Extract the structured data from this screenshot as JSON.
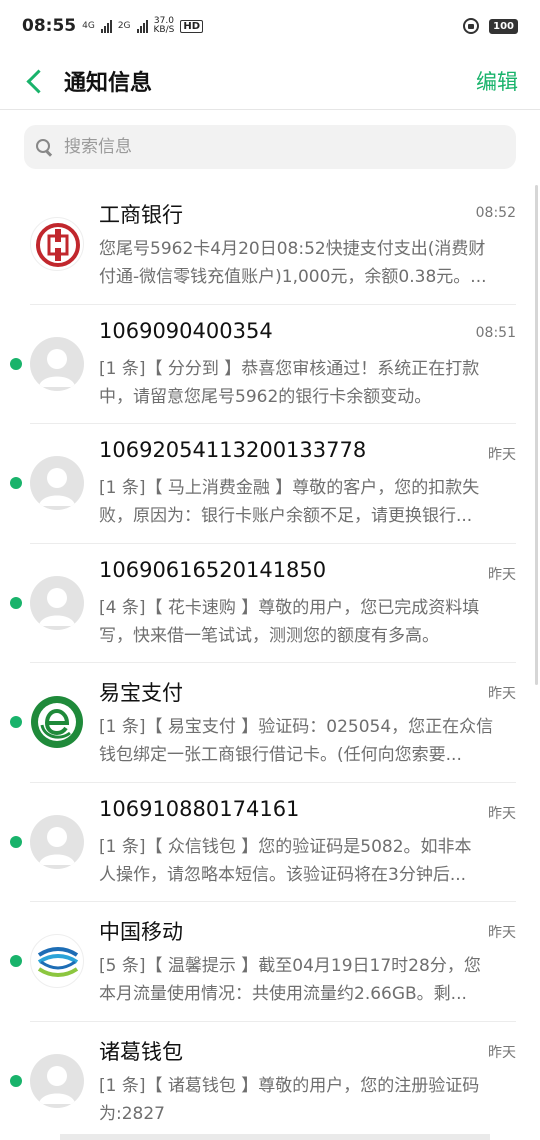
{
  "status": {
    "time": "08:55",
    "net": "4G",
    "net2": "2G",
    "speed_value": "37.0",
    "speed_unit": "KB/S",
    "hd": "HD",
    "battery": "100"
  },
  "header": {
    "title": "通知信息",
    "edit_label": "编辑"
  },
  "search": {
    "placeholder": "搜索信息"
  },
  "colors": {
    "accent": "#19b36b",
    "unread_dot": "#19b36b",
    "icbc_red": "#c1272d",
    "yeepay_green": "#1f8a3a",
    "cmcc_blue": "#1d6db5"
  },
  "messages": [
    {
      "sender": "工商银行",
      "time": "08:52",
      "unread": false,
      "avatar": "icbc-logo-icon",
      "line1": "您尾号5962卡4月20日08:52快捷支付支出(消费财",
      "line2": "付通-微信零钱充值账户)1,000元，余额0.38元。..."
    },
    {
      "sender": "1069090400354",
      "time": "08:51",
      "unread": true,
      "avatar": "default-avatar-icon",
      "line1": "[1 条]【 分分到 】恭喜您审核通过！系统正在打款",
      "line2": "中，请留意您尾号5962的银行卡余额变动。"
    },
    {
      "sender": "10692054113200133778",
      "time": "昨天",
      "unread": true,
      "avatar": "default-avatar-icon",
      "line1": "[1 条]【 马上消费金融 】尊敬的客户，您的扣款失",
      "line2": "败，原因为：银行卡账户余额不足，请更换银行..."
    },
    {
      "sender": "10690616520141850",
      "time": "昨天",
      "unread": true,
      "avatar": "default-avatar-icon",
      "line1": "[4 条]【 花卡速购 】尊敬的用户，您已完成资料填",
      "line2": "写，快来借一笔试试，测测您的额度有多高。"
    },
    {
      "sender": "易宝支付",
      "time": "昨天",
      "unread": true,
      "avatar": "yeepay-logo-icon",
      "line1": "[1 条]【 易宝支付 】验证码：025054，您正在众信",
      "line2": "钱包绑定一张工商银行借记卡。(任何向您索要..."
    },
    {
      "sender": "106910880174161",
      "time": "昨天",
      "unread": true,
      "avatar": "default-avatar-icon",
      "line1": "[1 条]【 众信钱包 】您的验证码是5082。如非本",
      "line2": "人操作，请忽略本短信。该验证码将在3分钟后..."
    },
    {
      "sender": "中国移动",
      "time": "昨天",
      "unread": true,
      "avatar": "china-mobile-logo-icon",
      "line1": "[5 条]【 温馨提示 】截至04月19日17时28分，您",
      "line2": "本月流量使用情况：共使用流量约2.66GB。剩..."
    },
    {
      "sender": "诸葛钱包",
      "time": "昨天",
      "unread": true,
      "avatar": "default-avatar-icon",
      "line1": "[1 条]【 诸葛钱包 】尊敬的用户，您的注册验证码",
      "line2": "为:2827"
    }
  ]
}
